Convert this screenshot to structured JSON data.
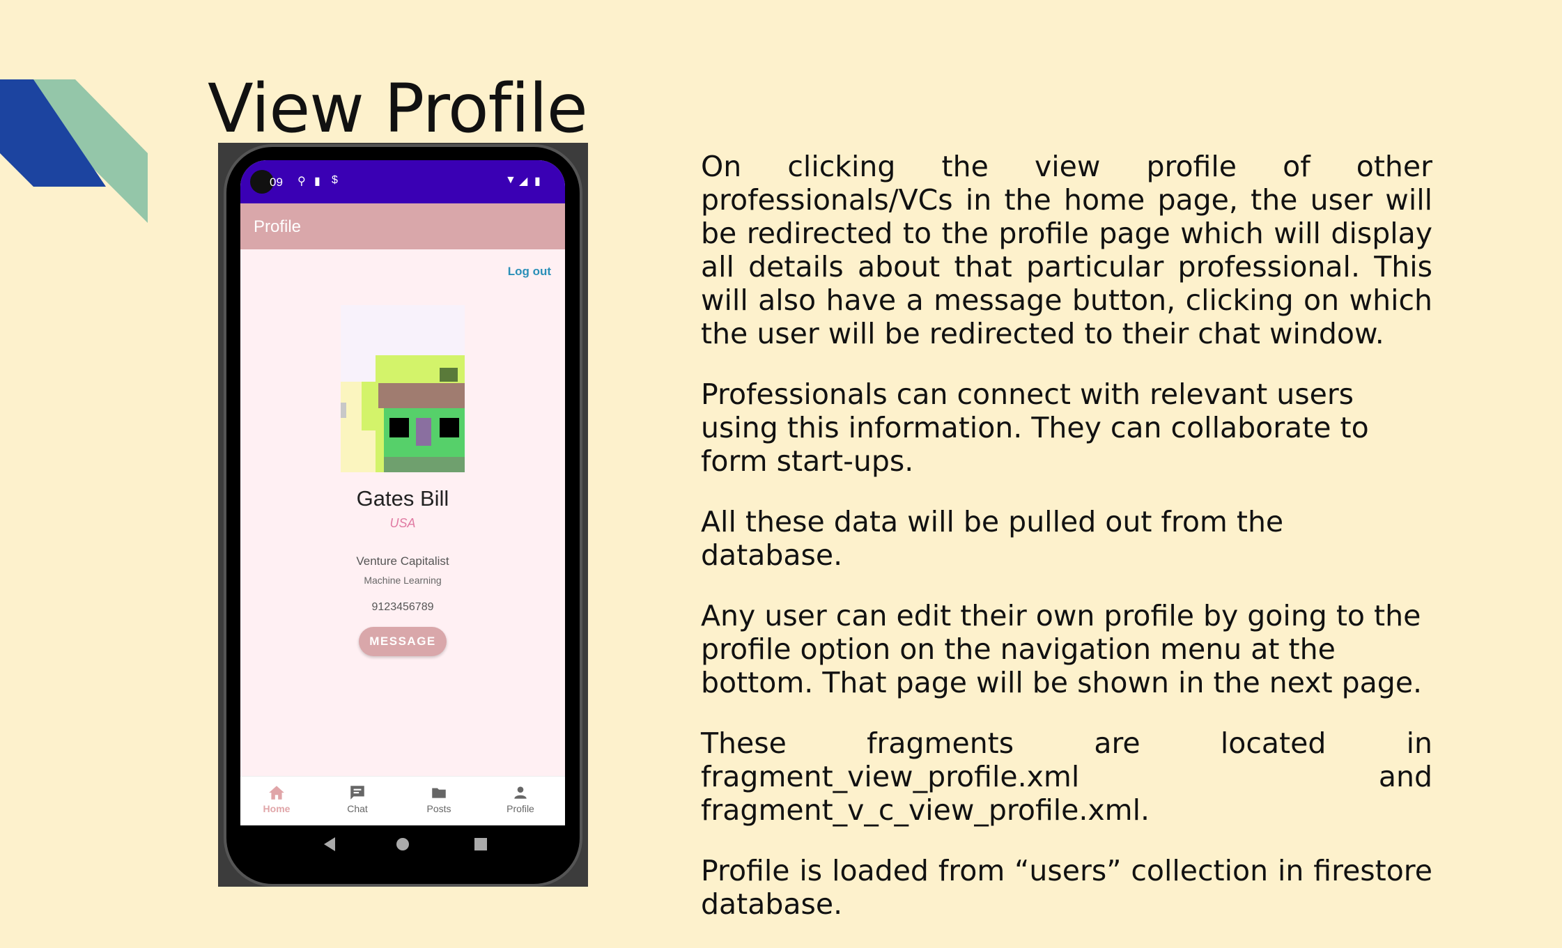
{
  "slide": {
    "title": "View Profile",
    "paragraphs": [
      "On clicking the view profile of other professionals/VCs in the home page, the user will be redirected to the profile page which will display all details about that particular professional. This will also have a message button, clicking on which the user will be redirected to their chat window.",
      "Professionals can connect with relevant users using this information. They can collaborate to form start-ups.",
      "All these data will be pulled out from the database.",
      "Any user can edit their own profile by going to the profile option on the navigation menu at the bottom. That page will be shown in the next page.",
      "These fragments are located in fragment_view_profile.xml and fragment_v_c_view_profile.xml.",
      "Profile is loaded from “users” collection in firestore database."
    ],
    "colors": {
      "background": "#fdf1cc",
      "deco_blue": "#1c44a0",
      "deco_green": "#94c6a9"
    }
  },
  "phone": {
    "status_time": "09",
    "appbar_title": "Profile",
    "logout_label": "Log out",
    "profile": {
      "name": "Gates Bill",
      "country": "USA",
      "role": "Venture Capitalist",
      "field": "Machine Learning",
      "phone": "9123456789"
    },
    "message_button": "MESSAGE",
    "nav": [
      {
        "label": "Home",
        "icon": "home-icon",
        "active": true
      },
      {
        "label": "Chat",
        "icon": "chat-icon",
        "active": false
      },
      {
        "label": "Posts",
        "icon": "posts-icon",
        "active": false
      },
      {
        "label": "Profile",
        "icon": "person-icon",
        "active": false
      }
    ],
    "colors": {
      "statusbar": "#3a00b4",
      "appbar": "#d9a7aa",
      "content": "#fff0f3",
      "logout": "#2a8fb8"
    }
  }
}
